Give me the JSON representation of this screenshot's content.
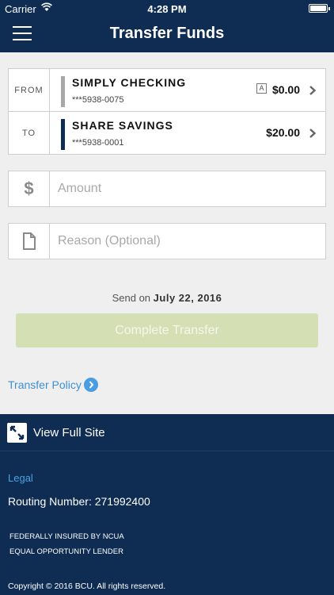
{
  "status_bar": {
    "carrier": "Carrier",
    "time": "4:28 PM"
  },
  "header": {
    "title": "Transfer Funds",
    "menu_icon": "hamburger-menu-icon"
  },
  "transfer": {
    "from": {
      "label": "FROM",
      "account_name": "SIMPLY CHECKING",
      "account_number": "***5938-0075",
      "badge": "A",
      "balance": "$0.00",
      "bar_color": "#a8a8a8"
    },
    "to": {
      "label": "TO",
      "account_name": "SHARE SAVINGS",
      "account_number": "***5938-0001",
      "balance": "$20.00",
      "bar_color": "#0f2c52"
    }
  },
  "amount": {
    "icon": "$",
    "placeholder": "Amount"
  },
  "reason": {
    "icon": "document-icon",
    "placeholder": "Reason (Optional)"
  },
  "send_on": {
    "prefix": "Send on",
    "date": "July 22, 2016"
  },
  "complete_button": {
    "label": "Complete Transfer",
    "enabled": false
  },
  "policy": {
    "label": "Transfer Policy",
    "icon": "chevron-right-circle-icon"
  },
  "footer": {
    "full_site_label": "View Full Site",
    "full_site_icon": "expand-icon",
    "legal_label": "Legal",
    "routing": "Routing Number: 271992400",
    "insured": "FEDERALLY INSURED BY NCUA",
    "lender": "EQUAL OPPORTUNITY LENDER",
    "copyright": "Copyright © 2016 BCU. All rights reserved."
  },
  "colors": {
    "navy": "#0f2c52",
    "link": "#3d8fd6",
    "button_disabled": "#d5dfb4"
  }
}
